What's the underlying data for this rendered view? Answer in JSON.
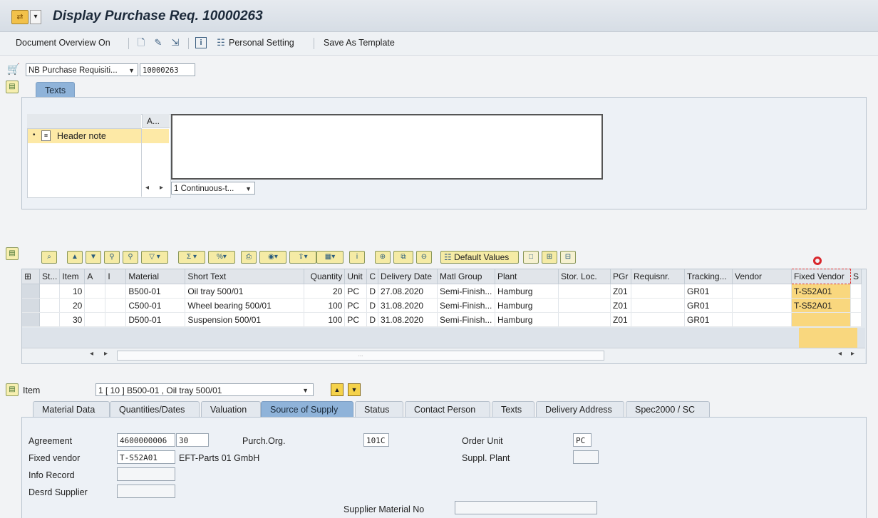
{
  "title": {
    "text": "Display Purchase Req. 10000263",
    "icon": "purchase-req-icon",
    "drop": "▾"
  },
  "toolbar": {
    "document_overview": "Document Overview On",
    "personal_setting": "Personal Setting",
    "save_as_template": "Save As Template"
  },
  "header": {
    "doc_type": "NB Purchase Requisiti...",
    "doc_number": "10000263",
    "dd": "▼"
  },
  "texts_tab": {
    "label": "Texts",
    "col_header": "A...",
    "tree_item": "Header note",
    "format": "1 Continuous-t...",
    "dd": "▼",
    "nav_left": "◂",
    "nav_right": "▸"
  },
  "grid": {
    "default_values": "Default Values",
    "columns": [
      "St...",
      "Item",
      "A",
      "I",
      "Material",
      "Short Text",
      "Quantity",
      "Unit",
      "C",
      "Delivery Date",
      "Matl Group",
      "Plant",
      "Stor. Loc.",
      "PGr",
      "Requisnr.",
      "Tracking...",
      "Vendor",
      "Fixed Vendor",
      "S"
    ],
    "rows": [
      {
        "item": "10",
        "material": "B500-01",
        "short_text": "Oil tray 500/01",
        "quantity": "20",
        "unit": "PC",
        "c": "D",
        "delivery_date": "27.08.2020",
        "matl_group": "Semi-Finish...",
        "plant": "Hamburg",
        "pgr": "Z01",
        "tracking": "GR01",
        "fixed_vendor": "T-S52A01"
      },
      {
        "item": "20",
        "material": "C500-01",
        "short_text": "Wheel bearing 500/01",
        "quantity": "100",
        "unit": "PC",
        "c": "D",
        "delivery_date": "31.08.2020",
        "matl_group": "Semi-Finish...",
        "plant": "Hamburg",
        "pgr": "Z01",
        "tracking": "GR01",
        "fixed_vendor": "T-S52A01"
      },
      {
        "item": "30",
        "material": "D500-01",
        "short_text": "Suspension 500/01",
        "quantity": "100",
        "unit": "PC",
        "c": "D",
        "delivery_date": "31.08.2020",
        "matl_group": "Semi-Finish...",
        "plant": "Hamburg",
        "pgr": "Z01",
        "tracking": "GR01",
        "fixed_vendor": ""
      }
    ],
    "scroll_left": "◂",
    "scroll_right": "▸",
    "scroll_grip": "..."
  },
  "item_detail": {
    "label": "Item",
    "selector": "1 [ 10 ] B500-01 , Oil tray 500/01",
    "dd": "▼",
    "up": "▲",
    "down": "▼",
    "tabs": [
      "Material Data",
      "Quantities/Dates",
      "Valuation",
      "Source of Supply",
      "Status",
      "Contact Person",
      "Texts",
      "Delivery Address",
      "Spec2000 / SC"
    ],
    "active_tab": "Source of Supply",
    "fields": {
      "agreement_label": "Agreement",
      "agreement_value": "4600000006",
      "agreement_item": "30",
      "purch_org_label": "Purch.Org.",
      "purch_org_value": "101C",
      "order_unit_label": "Order Unit",
      "order_unit_value": "PC",
      "fixed_vendor_label": "Fixed vendor",
      "fixed_vendor_value": "T-S52A01",
      "fixed_vendor_name": "EFT-Parts 01 GmbH",
      "suppl_plant_label": "Suppl. Plant",
      "info_record_label": "Info Record",
      "desrd_supplier_label": "Desrd Supplier",
      "supplier_material_label": "Supplier Material No"
    }
  },
  "colors": {
    "accent_tab": "#8fb3d9",
    "highlight": "#f9d77e",
    "cursor_ring": "#d9262c"
  }
}
